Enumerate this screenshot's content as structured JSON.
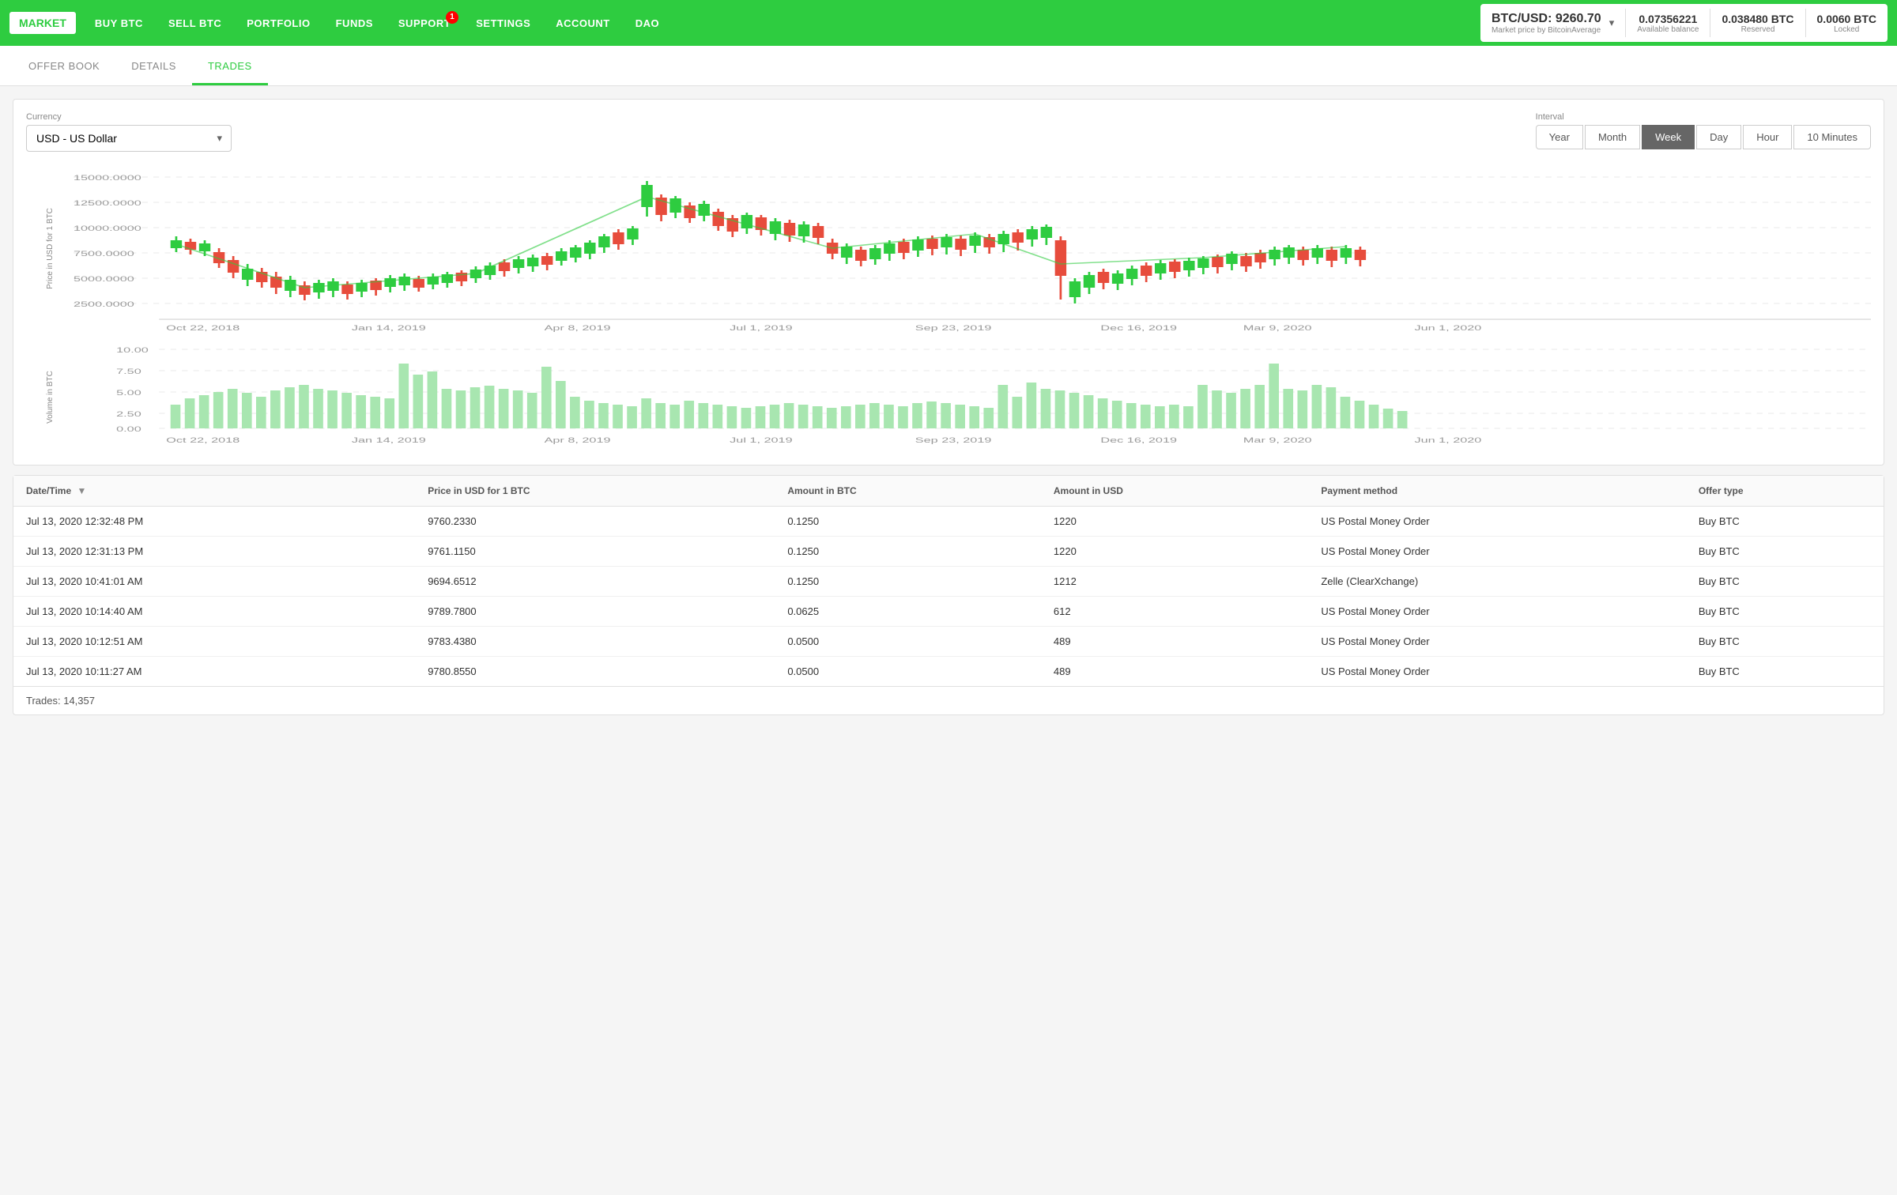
{
  "nav": {
    "brand": "MARKET",
    "items": [
      {
        "label": "BUY BTC",
        "id": "buy-btc"
      },
      {
        "label": "SELL BTC",
        "id": "sell-btc"
      },
      {
        "label": "PORTFOLIO",
        "id": "portfolio"
      },
      {
        "label": "FUNDS",
        "id": "funds"
      },
      {
        "label": "Support",
        "id": "support",
        "badge": 1
      },
      {
        "label": "Settings",
        "id": "settings"
      },
      {
        "label": "Account",
        "id": "account"
      },
      {
        "label": "DAO",
        "id": "dao"
      }
    ],
    "price": {
      "pair": "BTC/USD",
      "value": "9260.70",
      "subtitle": "Market price by BitcoinAverage",
      "available_balance": "0.07356221",
      "available_label": "Available balance",
      "reserved": "0.038480 BTC",
      "reserved_label": "Reserved",
      "locked": "0.0060 BTC",
      "locked_label": "Locked"
    }
  },
  "tabs": [
    {
      "label": "OFFER BOOK",
      "id": "offer-book"
    },
    {
      "label": "DETAILS",
      "id": "details"
    },
    {
      "label": "TRADES",
      "id": "trades",
      "active": true
    }
  ],
  "chart": {
    "currency_label": "Currency",
    "currency_value": "USD  -  US Dollar",
    "interval_label": "Interval",
    "interval_buttons": [
      {
        "label": "Year",
        "id": "year"
      },
      {
        "label": "Month",
        "id": "month"
      },
      {
        "label": "Week",
        "id": "week",
        "active": true
      },
      {
        "label": "Day",
        "id": "day"
      },
      {
        "label": "Hour",
        "id": "hour"
      },
      {
        "label": "10 Minutes",
        "id": "10min"
      }
    ],
    "y_axis_label": "Price in USD for 1 BTC",
    "volume_y_label": "Volume in BTC",
    "x_labels": [
      "Oct 22, 2018",
      "Jan 14, 2019",
      "Apr 8, 2019",
      "Jul 1, 2019",
      "Sep 23, 2019",
      "Dec 16, 2019",
      "Mar 9, 2020",
      "Jun 1, 2020"
    ],
    "y_labels": [
      "15000.0000",
      "12500.0000",
      "10000.0000",
      "7500.0000",
      "5000.0000",
      "2500.0000"
    ],
    "vol_y_labels": [
      "10.00",
      "7.50",
      "5.00",
      "2.50",
      "0.00"
    ]
  },
  "table": {
    "columns": [
      {
        "label": "Date/Time",
        "id": "datetime",
        "sortable": true
      },
      {
        "label": "Price in USD for 1 BTC",
        "id": "price"
      },
      {
        "label": "Amount in BTC",
        "id": "amount_btc"
      },
      {
        "label": "Amount in USD",
        "id": "amount_usd"
      },
      {
        "label": "Payment method",
        "id": "payment"
      },
      {
        "label": "Offer type",
        "id": "offer_type"
      }
    ],
    "rows": [
      {
        "datetime": "Jul 13, 2020 12:32:48 PM",
        "price": "9760.2330",
        "amount_btc": "0.1250",
        "amount_usd": "1220",
        "payment": "US Postal Money Order",
        "offer_type": "Buy BTC"
      },
      {
        "datetime": "Jul 13, 2020 12:31:13 PM",
        "price": "9761.1150",
        "amount_btc": "0.1250",
        "amount_usd": "1220",
        "payment": "US Postal Money Order",
        "offer_type": "Buy BTC"
      },
      {
        "datetime": "Jul 13, 2020 10:41:01 AM",
        "price": "9694.6512",
        "amount_btc": "0.1250",
        "amount_usd": "1212",
        "payment": "Zelle (ClearXchange)",
        "offer_type": "Buy BTC"
      },
      {
        "datetime": "Jul 13, 2020 10:14:40 AM",
        "price": "9789.7800",
        "amount_btc": "0.0625",
        "amount_usd": "612",
        "payment": "US Postal Money Order",
        "offer_type": "Buy BTC"
      },
      {
        "datetime": "Jul 13, 2020 10:12:51 AM",
        "price": "9783.4380",
        "amount_btc": "0.0500",
        "amount_usd": "489",
        "payment": "US Postal Money Order",
        "offer_type": "Buy BTC"
      },
      {
        "datetime": "Jul 13, 2020 10:11:27 AM",
        "price": "9780.8550",
        "amount_btc": "0.0500",
        "amount_usd": "489",
        "payment": "US Postal Money Order",
        "offer_type": "Buy BTC"
      }
    ],
    "trades_count_label": "Trades:",
    "trades_count": "14,357"
  }
}
